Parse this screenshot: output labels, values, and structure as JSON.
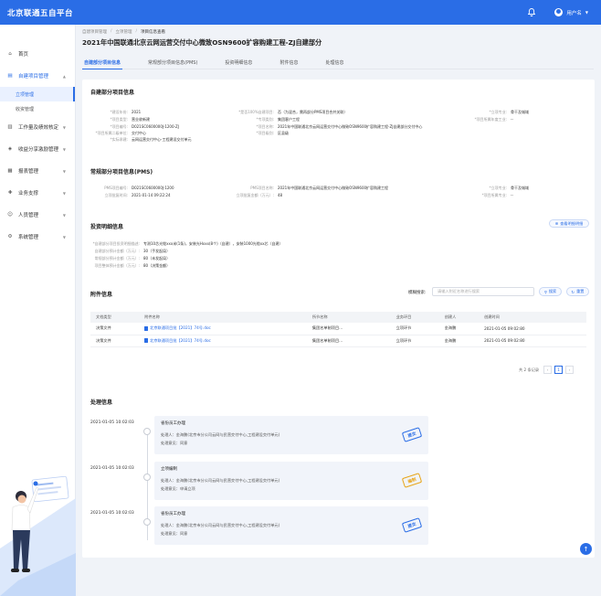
{
  "app": {
    "brand": "北京联通五自平台",
    "user": "用户名"
  },
  "sidebar": {
    "items": [
      {
        "label": "首页",
        "icon": "home-icon"
      },
      {
        "label": "自建项目管理",
        "icon": "folder-icon",
        "active": true
      },
      {
        "label": "工作量及绩效核定",
        "icon": "doc-icon"
      },
      {
        "label": "收益分享激励管理",
        "icon": "share-icon"
      },
      {
        "label": "报表管理",
        "icon": "chart-icon"
      },
      {
        "label": "业务支撑",
        "icon": "support-icon"
      },
      {
        "label": "人员管理",
        "icon": "user-icon"
      },
      {
        "label": "系统管理",
        "icon": "gear-icon"
      }
    ],
    "subs": [
      {
        "label": "立项管理"
      },
      {
        "label": "收资管理"
      }
    ]
  },
  "breadcrumb": [
    "自建项目管理",
    "立项管理",
    "项目信息查看"
  ],
  "page_title": "2021年中国联通北京云网运营交付中心微致OSN9600扩容购建工程-ZJ自建部分",
  "tabs": [
    "自建部分项目信息",
    "常规部分项目信息(PMS)",
    "投资明细信息",
    "附件信息",
    "处理信息"
  ],
  "self_info": {
    "title": "自建部分项目信息",
    "fields": [
      {
        "k": "*建设年份:",
        "v": "2021"
      },
      {
        "k": "*是否100%自建项目:",
        "v": "否（为混合，需再部分PMS项目合并关联）"
      },
      {
        "k": "*立项专业:",
        "v": "骨干及城域"
      },
      {
        "k": "*项目类型:",
        "v": "营业收新建"
      },
      {
        "k": "*专项类别:",
        "v": "集团客户工程"
      },
      {
        "k": "*项目所属年度工业:",
        "v": "--"
      },
      {
        "k": "*项目编号:",
        "v": "D021SC0600000J-1200-ZJ"
      },
      {
        "k": "*项目名称:",
        "v": "2021年中国联通北京云网运营交付中心微致OSN9600扩容购建工程-ZJ自建部分交付中心"
      },
      {
        "k": "*项目所属二级单位:",
        "v": "交付中心"
      },
      {
        "k": "*项目级别:",
        "v": "区县级"
      },
      {
        "k": "*实际承建:",
        "v": "云网运营交付中心-工程建设交付单元"
      }
    ]
  },
  "pms_info": {
    "title": "常规部分项目信息(PMS)",
    "fields": [
      {
        "k": "PMS项目编号:",
        "v": "D021SC0600000J-1200"
      },
      {
        "k": "PMS项目名称:",
        "v": "2021年中国联通北京云网运营交付中心微致OSN9600扩容购建工程"
      },
      {
        "k": "*立项专业:",
        "v": "骨干及城域"
      },
      {
        "k": "立项批复时间:",
        "v": "2021-01-14 09:22:24"
      },
      {
        "k": "立项批复金额（万元）:",
        "v": "48"
      },
      {
        "k": "*项目所属专业:",
        "v": "--"
      }
    ]
  },
  "invest_info": {
    "title": "投资明细信息",
    "button": "查看明细明细",
    "fields": [
      {
        "k": "*自建部分项目投资明细描述:",
        "v": "专测10芯光缆xxx米(1条)，安装光Hxxx(8个)（自建），安装1000光缆xx芯（自建）"
      },
      {
        "k": "自建部分预计金额（万元）:",
        "v": "30（手发起局）"
      },
      {
        "k": "常规部分预计金额（万元）:",
        "v": "80（未发起局）"
      },
      {
        "k": "项目整体预计金额（万元）:",
        "v": "80（决策金额）"
      }
    ]
  },
  "attachments": {
    "title": "附件信息",
    "search_label": "模糊搜索:",
    "search_placeholder": "请输入附近名称进行搜索",
    "search_btn": "搜索",
    "reset_btn": "重置",
    "columns": [
      "文档类型",
      "附件名称",
      "所节名称",
      "业务环目",
      "创建人",
      "创建时间"
    ],
    "rows": [
      {
        "type": "决策文件",
        "name": "北京联通项目批【2021】74号.doc",
        "node": "集团名单制项目...",
        "biz": "立项环节",
        "creator": "金海鹏",
        "time": "2021-01-05  09:02:80"
      },
      {
        "type": "决策文件",
        "name": "北京联通项目批【2021】74号.doc",
        "node": "集团名单制项目...",
        "biz": "立项环节",
        "creator": "金海鹏",
        "time": "2021-01-05  09:02:80"
      }
    ],
    "total": "共 2 条记录",
    "page": "1"
  },
  "process": {
    "title": "处理信息",
    "items": [
      {
        "time": "2021-01-05   10:02:03",
        "title": "省份员工办理",
        "handler": "处理人：金海鹏(北京市分公司云网与民营交付中心,工程建设交付单元)",
        "opinion": "处理意见：同意",
        "stamp": "提交",
        "stamp_color": "#2a6de6"
      },
      {
        "time": "2021-01-05   10:02:03",
        "title": "立项编制",
        "handler": "处理人：金海鹏(北京市分公司云网与民营交付中心,工程建设交付单元)",
        "opinion": "处理意见：申请立项",
        "stamp": "编制",
        "stamp_color": "#e8a416"
      },
      {
        "time": "2021-01-05   10:02:03",
        "title": "省份员工办理",
        "handler": "处理人：金海鹏(北京市分公司云网与民营交付中心,工程建设交付单元)",
        "opinion": "处理意见：同意",
        "stamp": "提交",
        "stamp_color": "#2a6de6"
      }
    ]
  }
}
